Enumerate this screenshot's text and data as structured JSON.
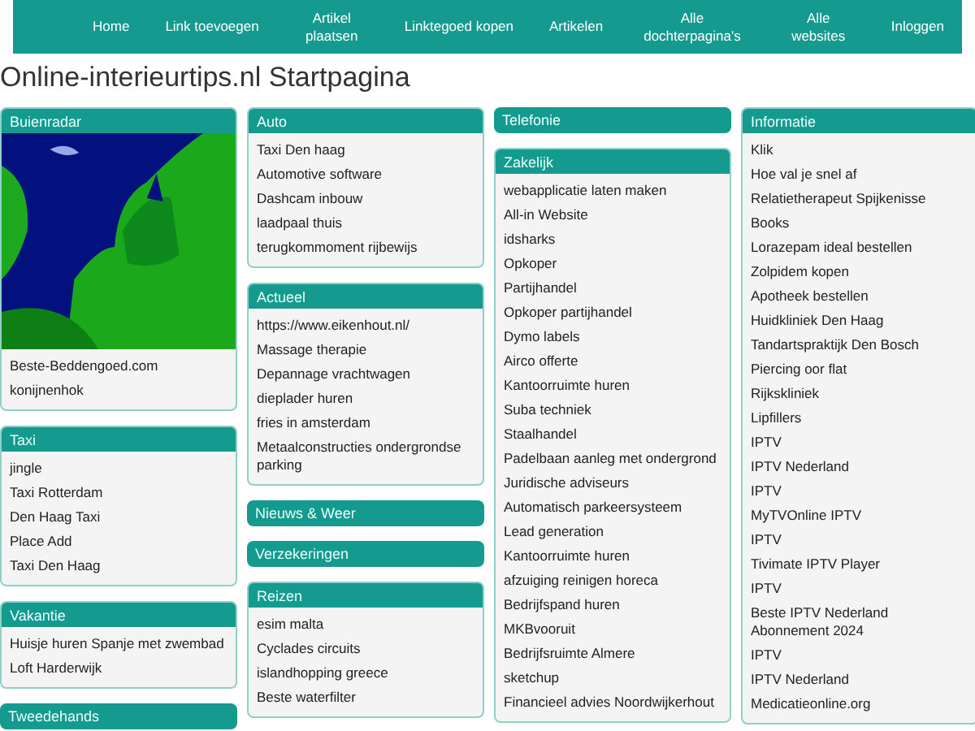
{
  "nav": [
    "Home",
    "Link toevoegen",
    "Artikel plaatsen",
    "Linktegoed kopen",
    "Artikelen",
    "Alle dochterpagina's",
    "Alle websites",
    "Inloggen"
  ],
  "title": "Online-interieurtips.nl Startpagina",
  "columns": [
    [
      {
        "title": "Buienradar",
        "items": [
          "Beste-Beddengoed.com",
          "konijnenhok"
        ]
      },
      {
        "title": "Taxi",
        "items": [
          "jingle",
          "Taxi Rotterdam",
          "Den Haag Taxi",
          "Place Add",
          "Taxi Den Haag"
        ]
      },
      {
        "title": "Vakantie",
        "items": [
          "Huisje huren Spanje met zwembad",
          "Loft Harderwijk"
        ]
      },
      {
        "title": "Tweedehands"
      }
    ],
    [
      {
        "title": "Auto",
        "items": [
          "Taxi Den haag",
          "Automotive software",
          "Dashcam inbouw",
          "laadpaal thuis",
          "terugkommoment rijbewijs"
        ]
      },
      {
        "title": "Actueel",
        "items": [
          "https://www.eikenhout.nl/",
          "Massage therapie",
          "Depannage vrachtwagen",
          "dieplader huren",
          "fries in amsterdam",
          "Metaalconstructies ondergrondse parking"
        ]
      },
      {
        "title": "Nieuws & Weer"
      },
      {
        "title": "Verzekeringen"
      },
      {
        "title": "Reizen",
        "items": [
          "esim malta",
          "Cyclades circuits",
          "islandhopping greece",
          "Beste waterfilter"
        ]
      }
    ],
    [
      {
        "title": "Telefonie"
      },
      {
        "title": "Zakelijk",
        "items": [
          "webapplicatie laten maken",
          "All-in Website",
          "idsharks",
          "Opkoper",
          "Partijhandel",
          "Opkoper partijhandel",
          "Dymo labels",
          "Airco offerte",
          "Kantoorruimte huren",
          "Suba techniek",
          "Staalhandel",
          "Padelbaan aanleg met ondergrond",
          "Juridische adviseurs",
          "Automatisch parkeersysteem",
          "Lead generation",
          "Kantoorruimte huren",
          "afzuiging reinigen horeca",
          "Bedrijfspand huren",
          "MKBvooruit",
          "Bedrijfsruimte Almere",
          "sketchup",
          "Financieel advies Noordwijkerhout"
        ]
      }
    ],
    [
      {
        "title": "Informatie",
        "items": [
          "Klik",
          "Hoe val je snel af",
          "Relatietherapeut Spijkenisse",
          "Books",
          "Lorazepam ideal bestellen",
          "Zolpidem kopen",
          "Apotheek bestellen",
          "Huidkliniek Den Haag",
          "Tandartspraktijk Den Bosch",
          "Piercing oor flat",
          "Rijkskliniek",
          "Lipfillers",
          "IPTV",
          "IPTV Nederland",
          "IPTV",
          "MyTVOnline IPTV",
          "IPTV",
          "Tivimate IPTV Player",
          "IPTV",
          "Beste IPTV Nederland Abonnement 2024",
          "IPTV",
          "IPTV Nederland",
          "Medicatieonline.org"
        ]
      }
    ]
  ]
}
